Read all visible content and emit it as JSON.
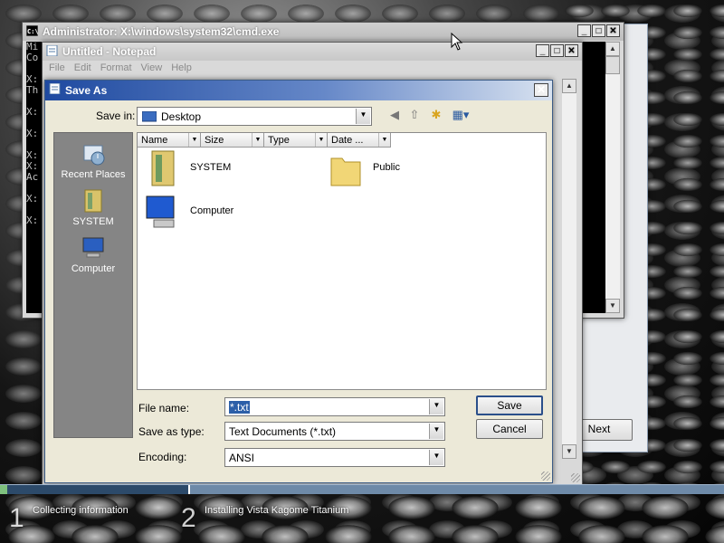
{
  "cmd": {
    "title": "Administrator: X:\\windows\\system32\\cmd.exe",
    "lines": [
      "Mi",
      "Co",
      "",
      "X:",
      "Th",
      "",
      "X:",
      "",
      "X:",
      "",
      "X:",
      "X:",
      "Ac",
      "",
      "X:",
      "",
      "X:"
    ]
  },
  "wizard": {
    "next_label": "Next"
  },
  "notepad": {
    "title": "Untitled - Notepad",
    "menu": [
      "File",
      "Edit",
      "Format",
      "View",
      "Help"
    ]
  },
  "saveas": {
    "title": "Save As",
    "save_in_label": "Save in:",
    "save_in_value": "Desktop",
    "places": [
      {
        "label": "Recent Places",
        "icon": "recent-places-icon"
      },
      {
        "label": "SYSTEM",
        "icon": "user-folder-icon"
      },
      {
        "label": "Computer",
        "icon": "computer-icon"
      }
    ],
    "columns": [
      "Name",
      "Size",
      "Type",
      "Date ..."
    ],
    "items": [
      {
        "label": "SYSTEM",
        "icon": "user-folder-icon"
      },
      {
        "label": "Public",
        "icon": "folder-icon"
      },
      {
        "label": "Computer",
        "icon": "computer-icon"
      }
    ],
    "file_name_label": "File name:",
    "file_name_value": "*.txt",
    "save_type_label": "Save as type:",
    "save_type_value": "Text Documents (*.txt)",
    "encoding_label": "Encoding:",
    "encoding_value": "ANSI",
    "save_button": "Save",
    "cancel_button": "Cancel"
  },
  "progress": {
    "step1_num": "1",
    "step1_label": "Collecting information",
    "step2_num": "2",
    "step2_label": "Installing Vista Kagome Titanium"
  }
}
